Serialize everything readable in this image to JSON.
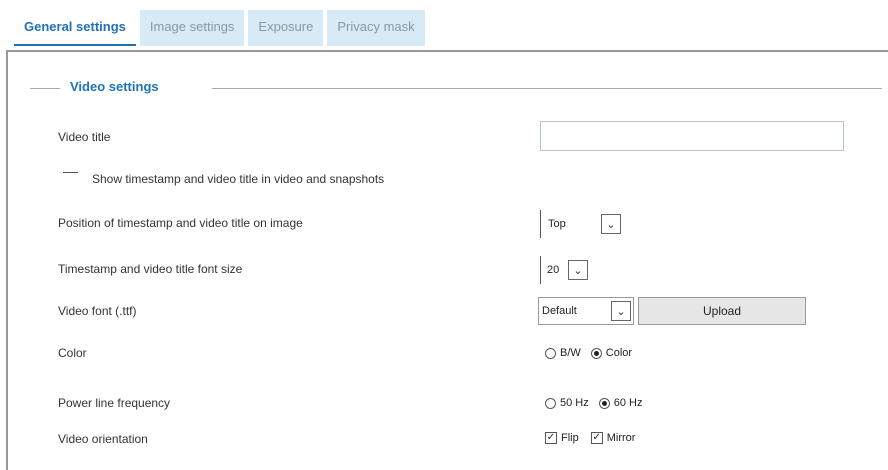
{
  "tabs": [
    {
      "label": "General settings",
      "active": true
    },
    {
      "label": "Image settings",
      "active": false
    },
    {
      "label": "Exposure",
      "active": false
    },
    {
      "label": "Privacy mask",
      "active": false
    }
  ],
  "section": {
    "legend": "Video settings"
  },
  "fields": {
    "video_title_label": "Video title",
    "video_title_value": "",
    "show_timestamp_label": "Show timestamp and video title in video and snapshots",
    "position_label": "Position of timestamp and video title on image",
    "position_value": "Top",
    "font_size_label": "Timestamp and video title font size",
    "font_size_value": "20",
    "video_font_label": "Video font (.ttf)",
    "video_font_value": "Default",
    "upload_label": "Upload",
    "color_label": "Color",
    "color_options": [
      "B/W",
      "Color"
    ],
    "color_selected": "Color",
    "powerline_label": "Power line frequency",
    "powerline_options": [
      "50 Hz",
      "60 Hz"
    ],
    "powerline_selected": "60 Hz",
    "orientation_label": "Video orientation",
    "orientation_options": [
      {
        "label": "Flip",
        "checked": true
      },
      {
        "label": "Mirror",
        "checked": true
      }
    ]
  },
  "colors": {
    "accent": "#1e73b8",
    "tab_bg": "#d7ebf7"
  }
}
